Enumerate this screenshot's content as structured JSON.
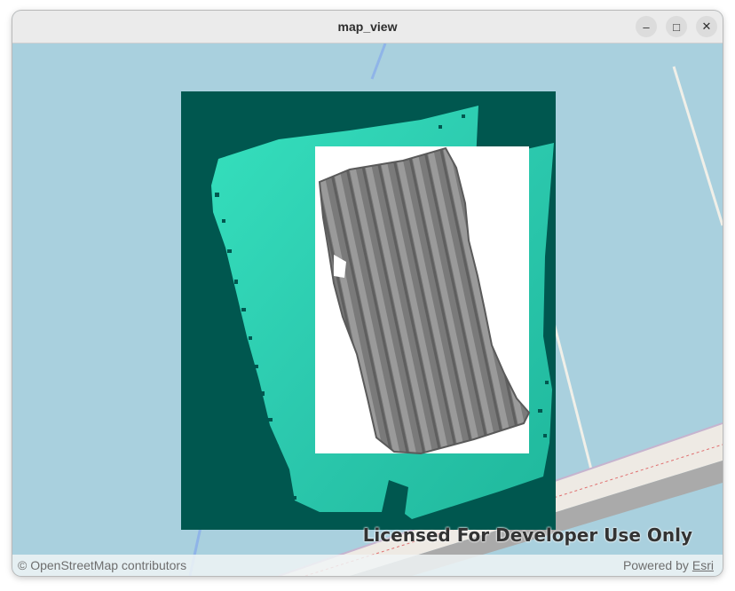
{
  "window": {
    "title": "map_view"
  },
  "controls": {
    "minimize": "–",
    "maximize": "□",
    "close": "✕"
  },
  "map": {
    "license_text": "Licensed For Developer Use Only",
    "attribution_left": "© OpenStreetMap contributors",
    "attribution_powered_by": "Powered by",
    "attribution_esri": "Esri"
  },
  "colors": {
    "water": "#a9d0de",
    "raster_frame": "#00574f",
    "bathymetry": "#2bd6b2",
    "mesh": "#7b7b7b"
  }
}
